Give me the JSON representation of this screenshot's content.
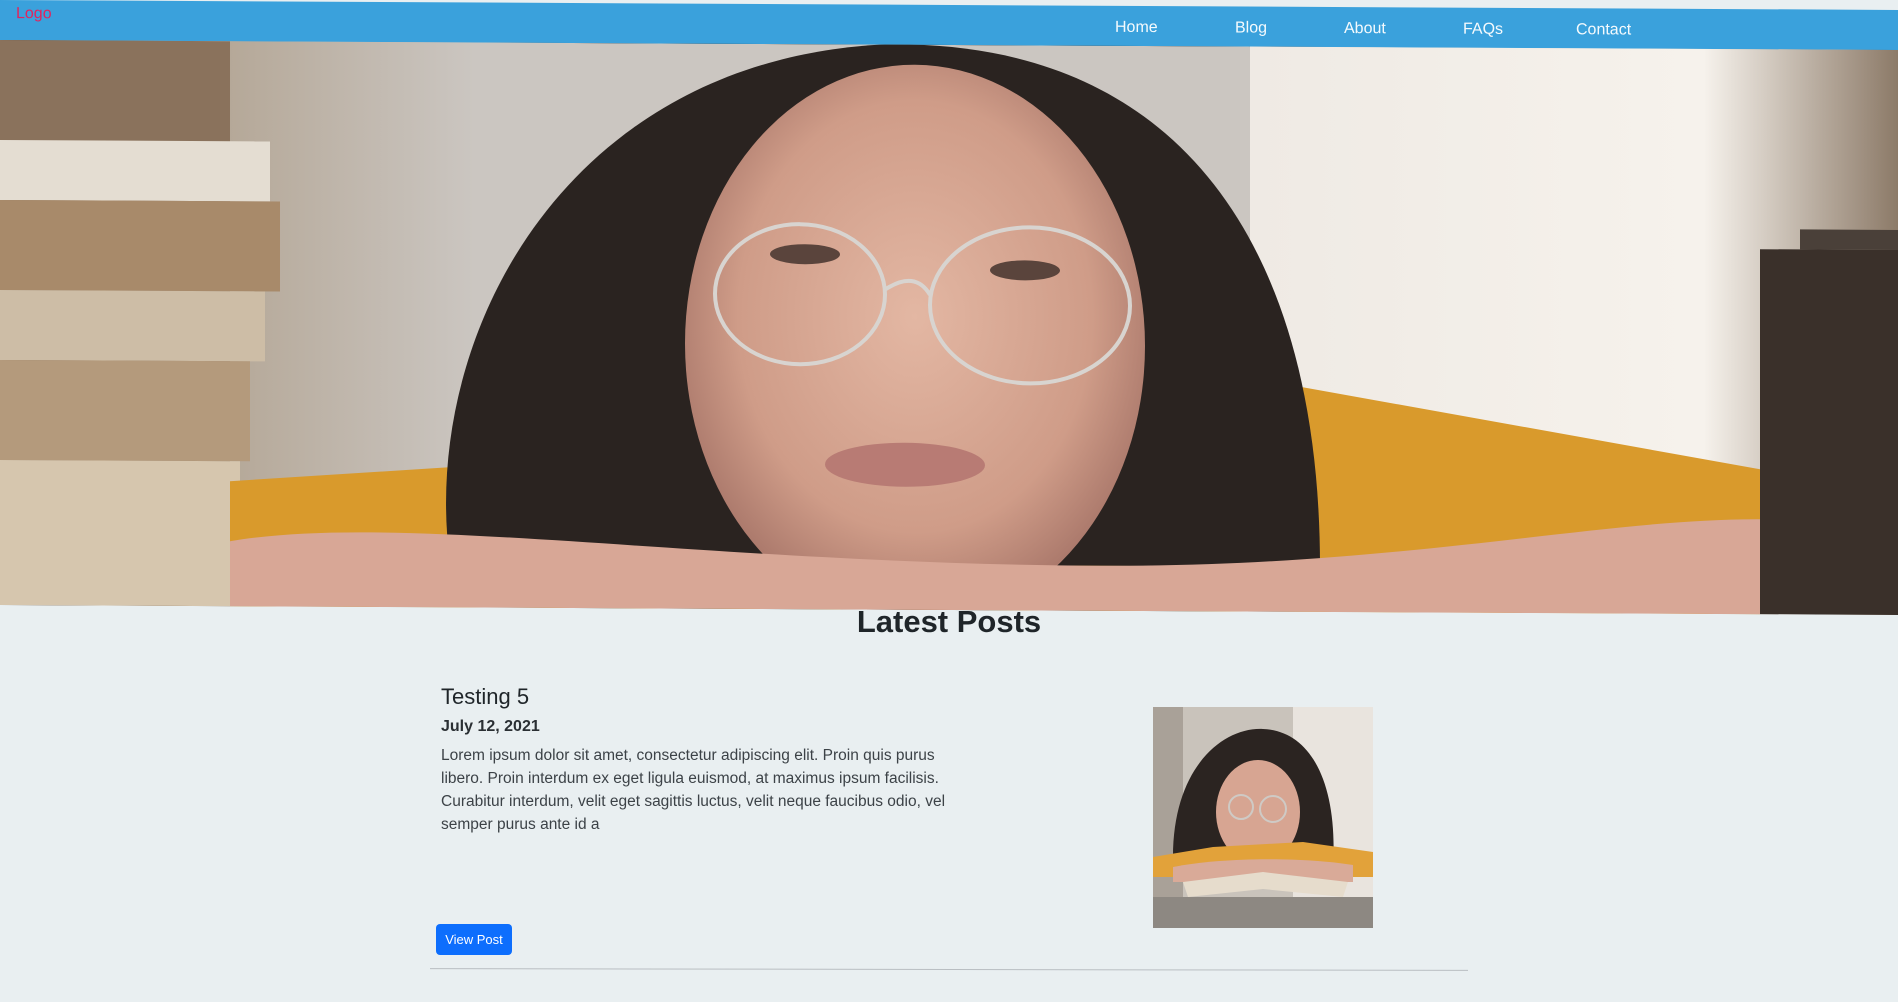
{
  "navbar": {
    "logo": "Logo",
    "links": [
      "Home",
      "Blog",
      "About",
      "FAQs",
      "Contact"
    ],
    "background_color": "#3aa1dc",
    "logo_color": "#e0245e"
  },
  "hero": {
    "image": "hero-photo"
  },
  "latest_posts": {
    "heading": "Latest Posts",
    "posts": [
      {
        "title": "Testing 5",
        "date": "July 12, 2021",
        "excerpt": "Lorem ipsum dolor sit amet, consectetur adipiscing elit. Proin quis purus libero. Proin interdum ex eget ligula euismod, at maximus ipsum facilisis. Curabitur interdum, velit eget sagittis luctus, velit neque faucibus odio, vel semper purus ante id a",
        "button_label": "View Post",
        "button_color": "#0d6efd"
      }
    ]
  }
}
